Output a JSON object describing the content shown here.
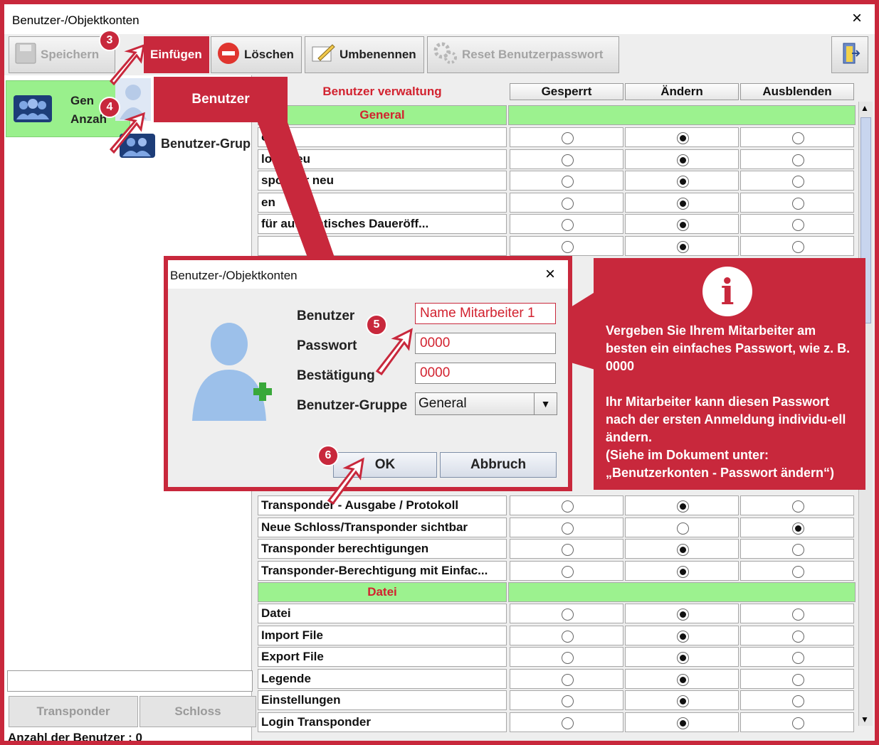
{
  "window": {
    "title": "Benutzer-/Objektkonten",
    "close": "×"
  },
  "toolbar": {
    "save": "Speichern",
    "insert": "Einfügen",
    "delete": "Löschen",
    "rename": "Umbenennen",
    "reset_password": "Reset Benutzerpasswort"
  },
  "left": {
    "group_line1": "Gen",
    "group_line2": "Anzah",
    "user_group_item": "Benutzer-Grup",
    "tab_transponder": "Transponder",
    "tab_lock": "Schloss",
    "status": "Anzahl der Benutzer : 0"
  },
  "table": {
    "headers": [
      "Benutzer verwaltung",
      "Gesperrt",
      "Ändern",
      "Ausblenden"
    ],
    "sections": {
      "general": "General",
      "file": "Datei"
    },
    "rows_top": [
      {
        "label": "out",
        "values": [
          false,
          true,
          false
        ]
      },
      {
        "label": "loss neu",
        "values": [
          false,
          true,
          false
        ]
      },
      {
        "label": "sponder neu",
        "values": [
          false,
          true,
          false
        ]
      },
      {
        "label": "en",
        "values": [
          false,
          true,
          false
        ]
      },
      {
        "label": "für automatisches Daueröff...",
        "values": [
          false,
          true,
          false
        ]
      },
      {
        "label": "",
        "values": [
          false,
          true,
          false
        ]
      }
    ],
    "rows_mid": [
      {
        "label": "Transponder - Ausgabe / Protokoll",
        "values": [
          false,
          true,
          false
        ]
      },
      {
        "label": "Neue Schloss/Transponder sichtbar",
        "values": [
          false,
          false,
          true
        ]
      },
      {
        "label": "Transponder berechtigungen",
        "values": [
          false,
          true,
          false
        ]
      },
      {
        "label": "Transponder-Berechtigung mit Einfac...",
        "values": [
          false,
          true,
          false
        ]
      }
    ],
    "rows_file": [
      {
        "label": "Datei",
        "values": [
          false,
          true,
          false
        ]
      },
      {
        "label": "Import File",
        "values": [
          false,
          true,
          false
        ]
      },
      {
        "label": "Export File",
        "values": [
          false,
          true,
          false
        ]
      },
      {
        "label": "Legende",
        "values": [
          false,
          true,
          false
        ]
      },
      {
        "label": "Einstellungen",
        "values": [
          false,
          true,
          false
        ]
      },
      {
        "label": "Login Transponder",
        "values": [
          false,
          true,
          false
        ]
      }
    ]
  },
  "callouts": {
    "benutzer": "Benutzer",
    "badges": [
      "3",
      "4",
      "5",
      "6"
    ]
  },
  "dialog": {
    "title": "Benutzer-/Objektkonten",
    "close": "×",
    "user_label": "Benutzer",
    "user_value": "Name Mitarbeiter 1",
    "password_label": "Passwort",
    "password_value": "0000",
    "confirm_label": "Bestätigung",
    "confirm_value": "0000",
    "group_label": "Benutzer-Gruppe",
    "group_value": "General",
    "ok": "OK",
    "cancel": "Abbruch"
  },
  "info": {
    "icon": "i",
    "p1": "Vergeben Sie Ihrem Mitarbeiter am besten ein einfaches Passwort, wie z. B. 0000",
    "p2": "Ihr Mitarbeiter kann diesen Passwort nach der ersten Anmeldung individu-ell ändern.",
    "p3": "(Siehe im Dokument unter: „Benutzerkonten - Passwort ändern“)"
  },
  "colors": {
    "accent": "#c8283c",
    "section_green": "#9cf28f",
    "group_green": "#99f08c"
  }
}
